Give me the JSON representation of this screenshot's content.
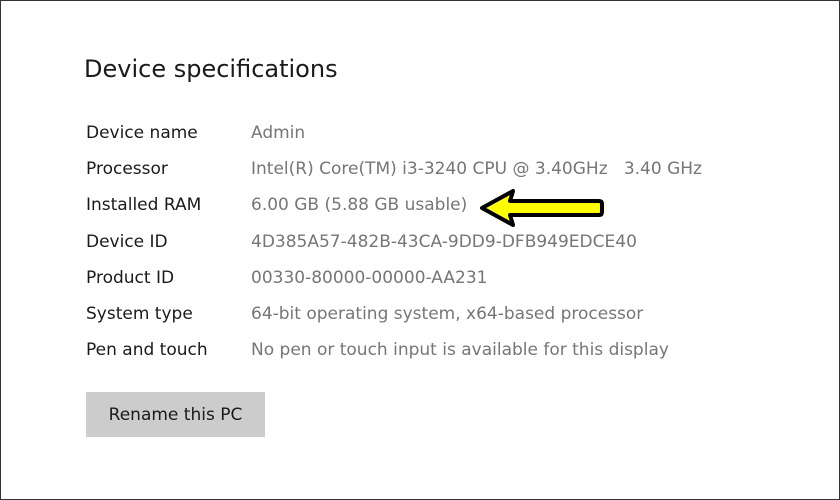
{
  "section": {
    "title": "Device specifications"
  },
  "specs": [
    {
      "label": "Device name",
      "value": "Admin"
    },
    {
      "label": "Processor",
      "value": "Intel(R) Core(TM) i3-3240 CPU @ 3.40GHz   3.40 GHz"
    },
    {
      "label": "Installed RAM",
      "value": "6.00 GB (5.88 GB usable)"
    },
    {
      "label": "Device ID",
      "value": "4D385A57-482B-43CA-9DD9-DFB949EDCE40"
    },
    {
      "label": "Product ID",
      "value": "00330-80000-00000-AA231"
    },
    {
      "label": "System type",
      "value": "64-bit operating system, x64-based processor"
    },
    {
      "label": "Pen and touch",
      "value": "No pen or touch input is available for this display"
    }
  ],
  "actions": {
    "rename_label": "Rename this PC"
  },
  "annotation": {
    "icon": "arrow-left-icon",
    "color": "#ffff00",
    "outline": "#000000"
  }
}
